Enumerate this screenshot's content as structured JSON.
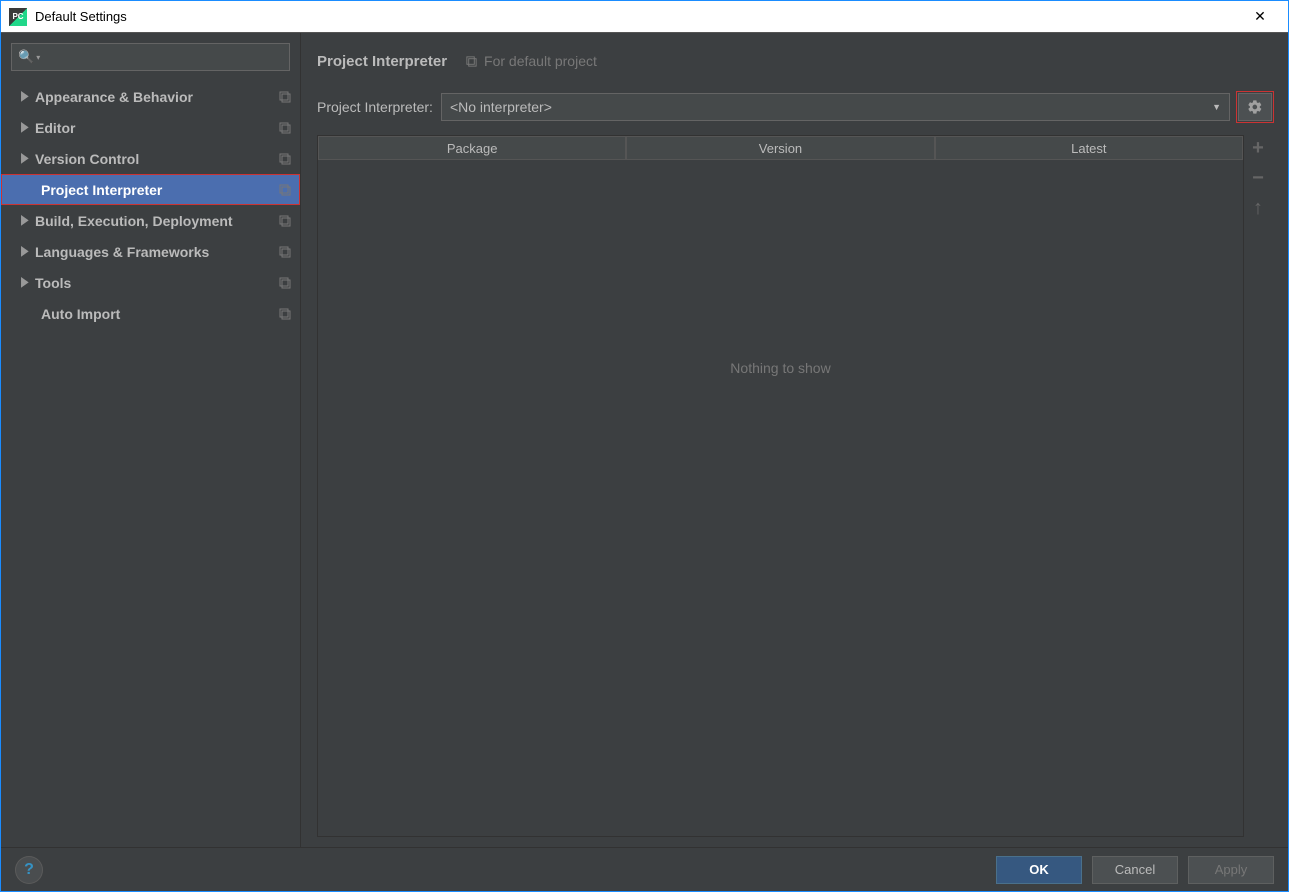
{
  "window_title": "Default Settings",
  "sidebar": {
    "items": [
      {
        "label": "Appearance & Behavior",
        "expandable": true,
        "copy": true
      },
      {
        "label": "Editor",
        "expandable": true,
        "copy": true
      },
      {
        "label": "Version Control",
        "expandable": true,
        "copy": true
      },
      {
        "label": "Project Interpreter",
        "expandable": false,
        "copy": true,
        "selected": true
      },
      {
        "label": "Build, Execution, Deployment",
        "expandable": true,
        "copy": true
      },
      {
        "label": "Languages & Frameworks",
        "expandable": true,
        "copy": true
      },
      {
        "label": "Tools",
        "expandable": true,
        "copy": true
      },
      {
        "label": "Auto Import",
        "expandable": false,
        "copy": true
      }
    ]
  },
  "breadcrumb": {
    "main": "Project Interpreter",
    "sub": "For default project"
  },
  "interpreter": {
    "label": "Project Interpreter:",
    "selected": "<No interpreter>"
  },
  "table": {
    "headers": [
      "Package",
      "Version",
      "Latest"
    ],
    "empty_text": "Nothing to show"
  },
  "footer": {
    "ok": "OK",
    "cancel": "Cancel",
    "apply": "Apply"
  }
}
